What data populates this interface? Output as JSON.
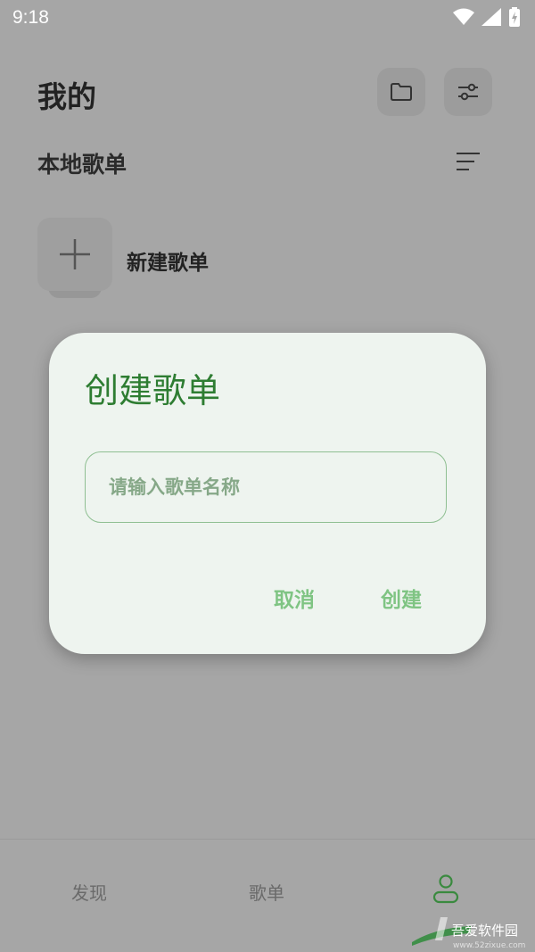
{
  "status_bar": {
    "time": "9:18"
  },
  "header": {
    "title": "我的"
  },
  "section": {
    "title": "本地歌单"
  },
  "new_playlist": {
    "label": "新建歌单"
  },
  "dialog": {
    "title": "创建歌单",
    "input_placeholder": "请输入歌单名称",
    "input_value": "",
    "cancel_label": "取消",
    "create_label": "创建"
  },
  "bottom_nav": {
    "items": [
      {
        "label": "发现"
      },
      {
        "label": "歌单"
      }
    ],
    "active_item_icon": "person-icon"
  },
  "watermark": {
    "text": "吾爱软件园",
    "url": "www.52zixue.com"
  },
  "colors": {
    "accent": "#2e7d32",
    "button_text": "#7fc483",
    "dialog_bg": "#eef4ef"
  }
}
